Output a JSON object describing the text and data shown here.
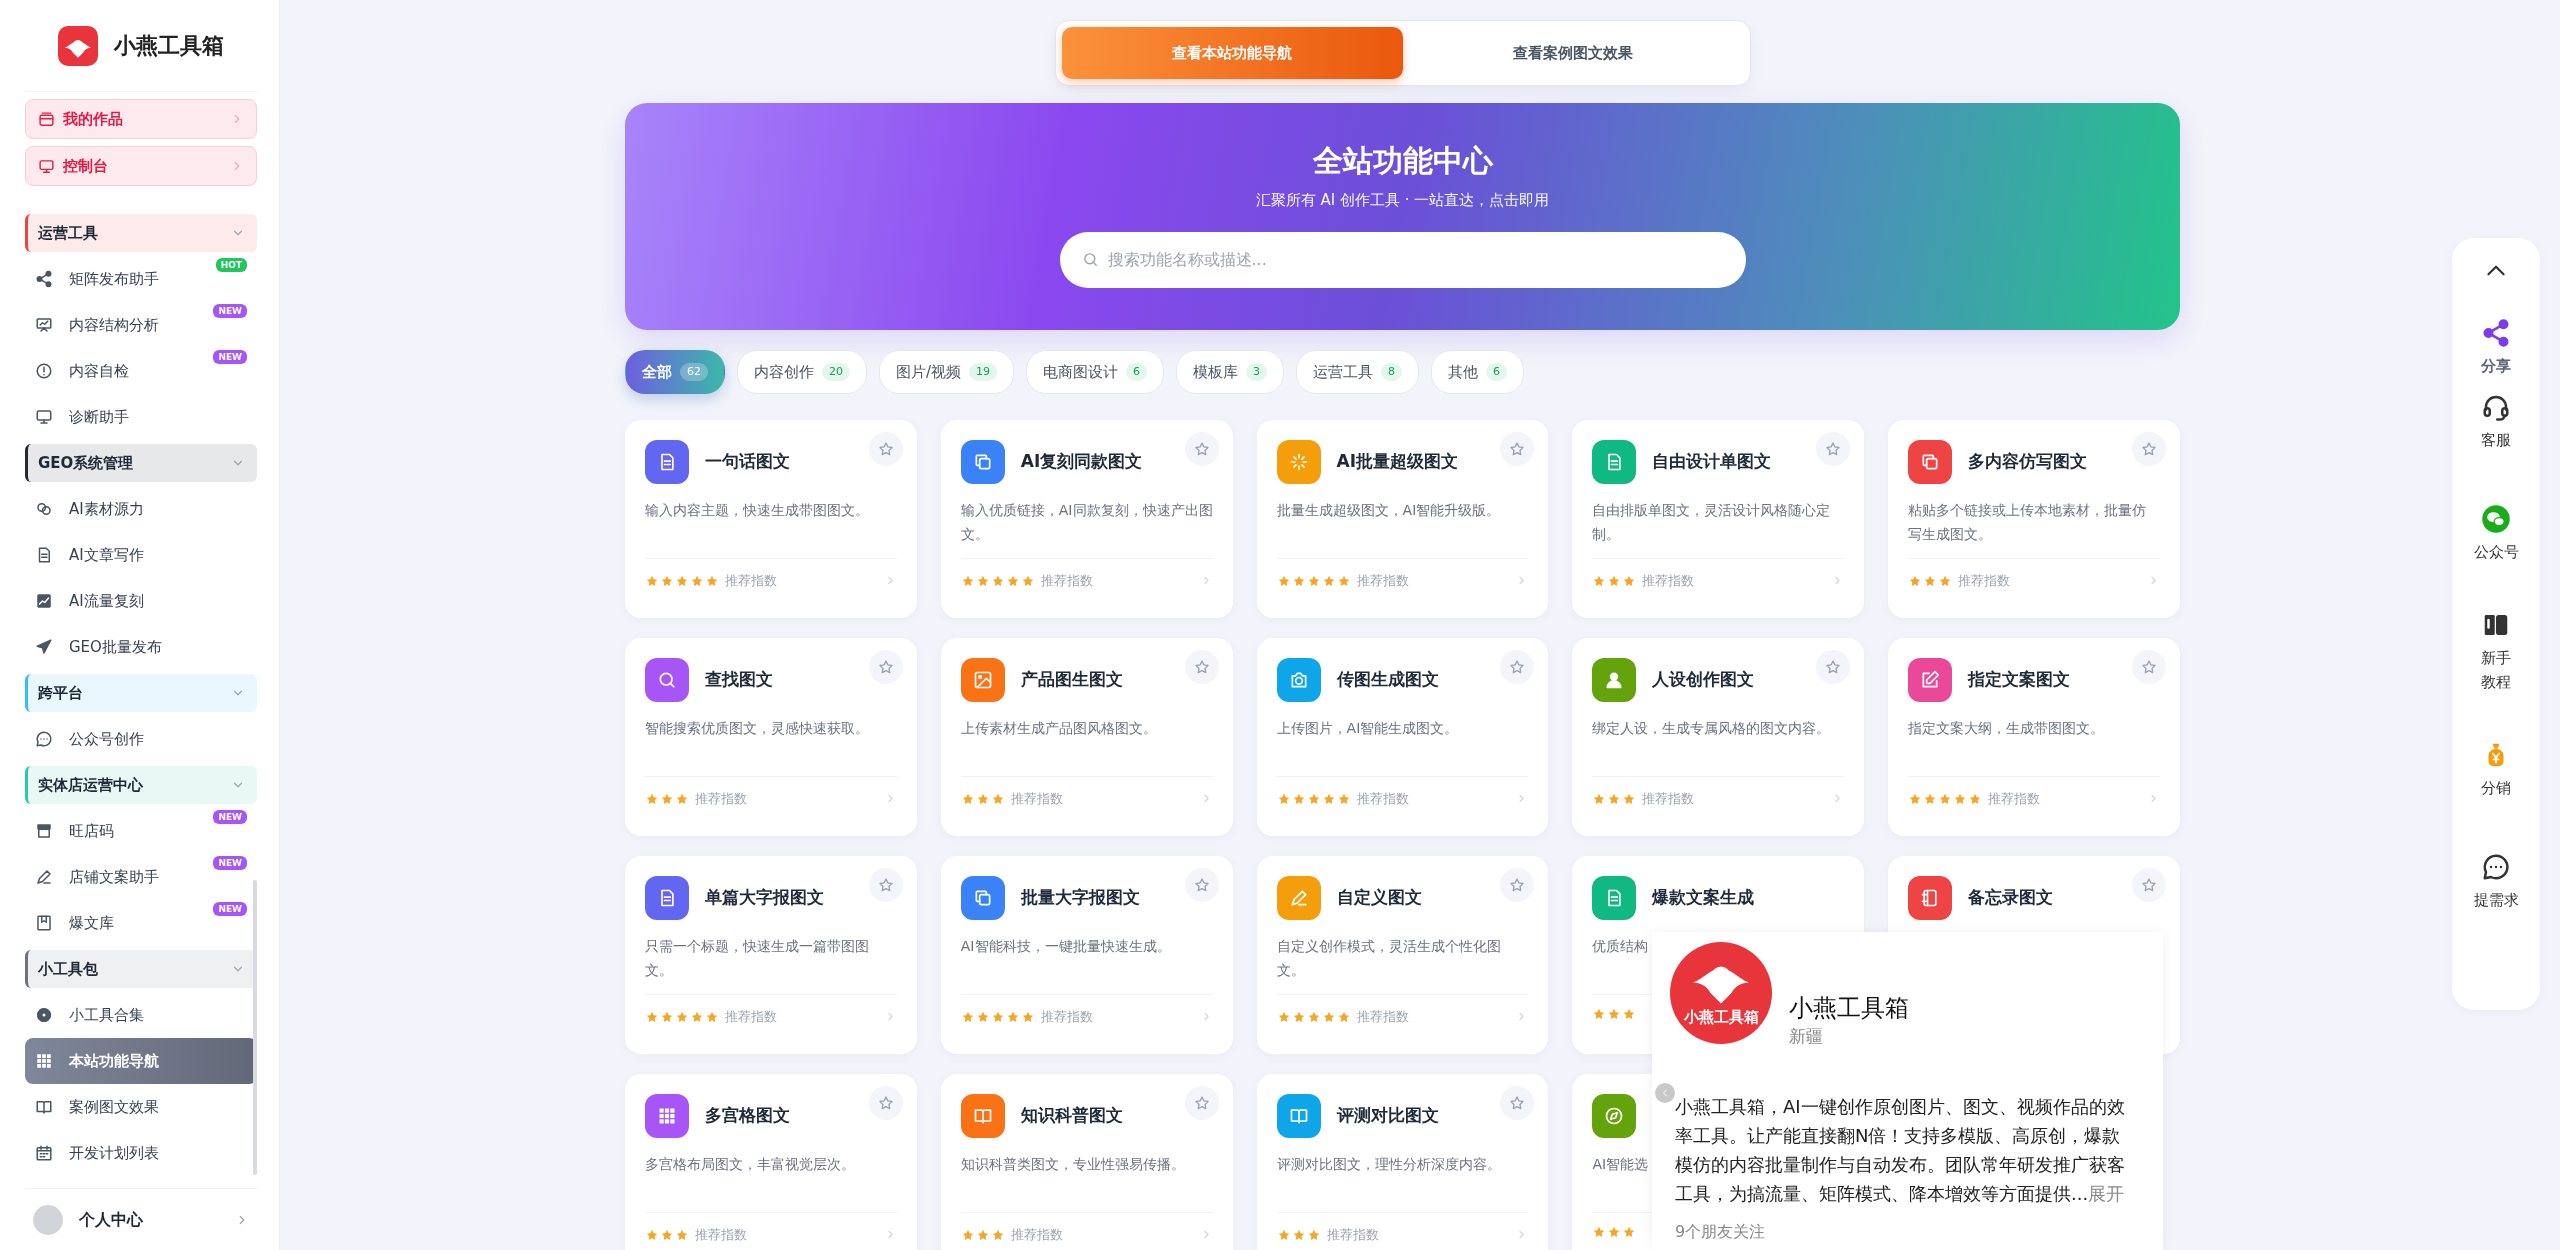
{
  "sidebar": {
    "logo_text": "小燕工具箱",
    "top_buttons": [
      {
        "label": "我的作品"
      },
      {
        "label": "控制台"
      }
    ],
    "groups": [
      {
        "title": "运营工具",
        "expanded": true,
        "color": "#ef4444",
        "items": [
          {
            "label": "矩阵发布助手",
            "badge": "HOT",
            "selected": false
          },
          {
            "label": "内容结构分析",
            "badge": "NEW",
            "selected": false
          },
          {
            "label": "内容自检",
            "badge": "NEW",
            "selected": false
          },
          {
            "label": "诊断助手",
            "selected": false
          }
        ]
      },
      {
        "title": "GEO系统管理",
        "expanded": true,
        "color": "#1f2937",
        "items": [
          {
            "label": "AI素材源力",
            "selected": false
          },
          {
            "label": "AI文章写作",
            "selected": false
          },
          {
            "label": "AI流量复刻",
            "selected": false
          },
          {
            "label": "GEO批量发布",
            "selected": false
          }
        ]
      },
      {
        "title": "跨平台",
        "expanded": true,
        "color": "#38bdf8",
        "items": [
          {
            "label": "公众号创作",
            "selected": false
          }
        ]
      },
      {
        "title": "实体店运营中心",
        "expanded": true,
        "color": "#2cc9a8",
        "items": [
          {
            "label": "旺店码",
            "badge": "NEW",
            "selected": false
          },
          {
            "label": "店铺文案助手",
            "badge": "NEW",
            "selected": false
          },
          {
            "label": "爆文库",
            "badge": "NEW",
            "selected": false
          }
        ]
      },
      {
        "title": "小工具包",
        "expanded": true,
        "color": "#6b7280",
        "items": [
          {
            "label": "小工具合集",
            "selected": false
          },
          {
            "label": "本站功能导航",
            "selected": true
          },
          {
            "label": "案例图文效果",
            "selected": false
          },
          {
            "label": "开发计划列表",
            "selected": false
          }
        ]
      }
    ],
    "user": {
      "label": "个人中心"
    }
  },
  "view_toggle": [
    {
      "label": "查看本站功能导航",
      "selected": true
    },
    {
      "label": "查看案例图文效果",
      "selected": false
    }
  ],
  "hero": {
    "title": "全站功能中心",
    "subtitle": "汇聚所有 AI 创作工具 · 一站直达，点击即用",
    "search": {
      "placeholder": "搜索功能名称或描述..."
    }
  },
  "filters": [
    {
      "label": "全部",
      "count": "62",
      "selected": true
    },
    {
      "label": "内容创作",
      "count": "20",
      "selected": false
    },
    {
      "label": "图片/视频",
      "count": "19",
      "selected": false
    },
    {
      "label": "电商图设计",
      "count": "6",
      "selected": false
    },
    {
      "label": "模板库",
      "count": "3",
      "selected": false
    },
    {
      "label": "运营工具",
      "count": "8",
      "selected": false
    },
    {
      "label": "其他",
      "count": "6",
      "selected": false
    }
  ],
  "cards": [
    {
      "kind": "full",
      "title": "一句话图文",
      "description": "输入内容主题，快速生成带图图文。",
      "stars": 5,
      "rating_label": "推荐指数",
      "color": "#6366f1"
    },
    {
      "kind": "full",
      "title": "AI复刻同款图文",
      "description": "输入优质链接，AI同款复刻，快速产出图文。",
      "stars": 5,
      "rating_label": "推荐指数",
      "color": "#3b82f6"
    },
    {
      "kind": "full",
      "title": "AI批量超级图文",
      "description": "批量生成超级图文，AI智能升级版。",
      "stars": 5,
      "rating_label": "推荐指数",
      "color": "#f59e0b"
    },
    {
      "kind": "full",
      "title": "自由设计单图文",
      "description": "自由排版单图文，灵活设计风格随心定制。",
      "stars": 3,
      "rating_label": "推荐指数",
      "color": "#10b981"
    },
    {
      "kind": "full",
      "title": "多内容仿写图文",
      "description": "粘贴多个链接或上传本地素材，批量仿写生成图文。",
      "stars": 3,
      "rating_label": "推荐指数",
      "color": "#ef4444"
    },
    {
      "kind": "full",
      "title": "查找图文",
      "description": "智能搜索优质图文，灵感快速获取。",
      "stars": 3,
      "rating_label": "推荐指数",
      "color": "#a855f7"
    },
    {
      "kind": "full",
      "title": "产品图生图文",
      "description": "上传素材生成产品图风格图文。",
      "stars": 3,
      "rating_label": "推荐指数",
      "color": "#f97316"
    },
    {
      "kind": "full",
      "title": "传图生成图文",
      "description": "上传图片，AI智能生成图文。",
      "stars": 5,
      "rating_label": "推荐指数",
      "color": "#0ea5e9"
    },
    {
      "kind": "full",
      "title": "人设创作图文",
      "description": "绑定人设，生成专属风格的图文内容。",
      "stars": 3,
      "rating_label": "推荐指数",
      "color": "#65a30d"
    },
    {
      "kind": "full",
      "title": "指定文案图文",
      "description": "指定文案大纲，生成带图图文。",
      "stars": 5,
      "rating_label": "推荐指数",
      "color": "#ec4899"
    },
    {
      "kind": "full",
      "title": "单篇大字报图文",
      "description": "只需一个标题，快速生成一篇带图图文。",
      "stars": 5,
      "rating_label": "推荐指数",
      "color": "#6366f1"
    },
    {
      "kind": "full",
      "title": "批量大字报图文",
      "description": "AI智能科技，一键批量快速生成。",
      "stars": 5,
      "rating_label": "推荐指数",
      "color": "#3b82f6"
    },
    {
      "kind": "full",
      "title": "自定义图文",
      "description": "自定义创作模式，灵活生成个性化图文。",
      "stars": 5,
      "rating_label": "推荐指数",
      "color": "#f59e0b"
    },
    {
      "kind": "partial",
      "title": "爆款文案生成",
      "description": "优质结构",
      "stars": 3,
      "color": "#10b981"
    },
    {
      "kind": "head",
      "title": "备忘录图文",
      "color": "#ef4444"
    },
    {
      "kind": "full",
      "title": "多宫格图文",
      "description": "多宫格布局图文，丰富视觉层次。",
      "stars": 3,
      "rating_label": "推荐指数",
      "color": "#a855f7"
    },
    {
      "kind": "full",
      "title": "知识科普图文",
      "description": "知识科普类图文，专业性强易传播。",
      "stars": 3,
      "rating_label": "推荐指数",
      "color": "#f97316"
    },
    {
      "kind": "full",
      "title": "评测对比图文",
      "description": "评测对比图文，理性分析深度内容。",
      "stars": 3,
      "rating_label": "推荐指数",
      "color": "#0ea5e9"
    },
    {
      "kind": "partial",
      "description": "AI智能选",
      "stars": 3,
      "color": "#65a30d"
    }
  ],
  "profile_popup": {
    "logo_caption": "小燕工具箱",
    "name": "小燕工具箱",
    "region": "新疆",
    "description": "小燕工具箱，AI一键创作原创图片、图文、视频作品的效率工具。让产能直接翻N倍！支持多模版、高原创，爆款模仿的内容批量制作与自动发布。团队常年研发推广获客工具，为搞流量、矩阵模式、降本增效等方面提供...",
    "expand": "展开",
    "followers": "9个朋友关注"
  },
  "right_rail": [
    {
      "label": "分享",
      "selected": true
    },
    {
      "label": "客服",
      "selected": false
    },
    {
      "label": "公众号",
      "selected": false
    },
    {
      "label": "新手教程",
      "selected": false
    },
    {
      "label": "分销",
      "selected": false
    },
    {
      "label": "提需求",
      "selected": false
    }
  ]
}
